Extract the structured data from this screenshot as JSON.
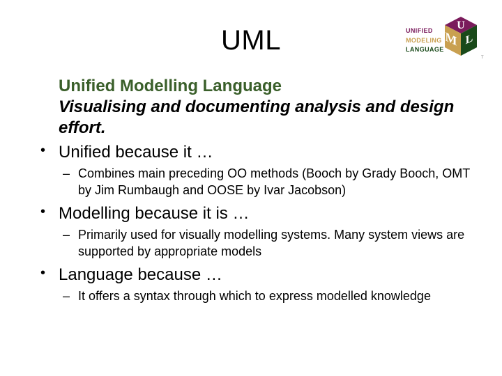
{
  "title": "UML",
  "logo": {
    "line1": "UNIFIED",
    "line2": "MODELING",
    "line3": "LANGUAGE"
  },
  "subtitle": "Unified Modelling Language",
  "emphasis": "Visualising and documenting analysis and design effort.",
  "bullets": [
    {
      "text": "Unified because it …",
      "sub": [
        "Combines main preceding OO methods (Booch by Grady Booch, OMT by Jim Rumbaugh and OOSE by Ivar Jacobson)"
      ]
    },
    {
      "text": "Modelling because it is …",
      "sub": [
        "Primarily used for visually modelling systems. Many system views are supported by appropriate models"
      ]
    },
    {
      "text": "Language because …",
      "sub": [
        "It offers a syntax through which to express modelled knowledge"
      ]
    }
  ]
}
